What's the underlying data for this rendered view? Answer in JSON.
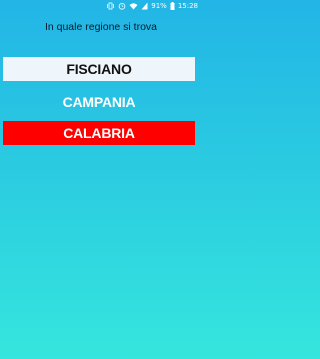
{
  "status_bar": {
    "battery_percent": "91%",
    "time": "15:28",
    "icons": [
      "vibrate-icon",
      "alarm-icon",
      "wifi-icon",
      "signal-icon",
      "battery-icon"
    ]
  },
  "question": "In quale regione si trova",
  "options": [
    {
      "label": "FISCIANO",
      "state": "default"
    },
    {
      "label": "CAMPANIA",
      "state": "default"
    },
    {
      "label": "CALABRIA",
      "state": "selected-wrong"
    }
  ],
  "colors": {
    "background_top": "#22b5e6",
    "background_bottom": "#35e6dd",
    "option_light": "#eef6fb",
    "option_wrong": "#ff0000"
  }
}
